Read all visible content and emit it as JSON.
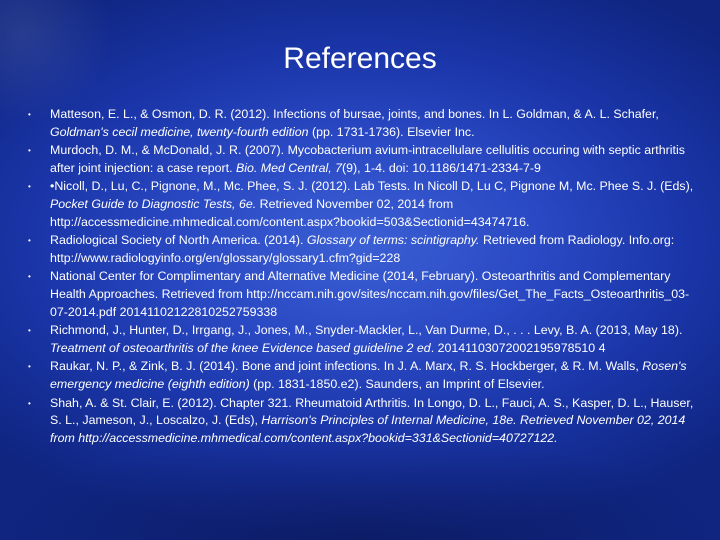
{
  "title": "References",
  "bullet": "•",
  "references": [
    [
      {
        "t": "Matteson, E. L., & Osmon, D. R. (2012). Infections of bursae, joints, and bones. In L. Goldman, & A. L. Schafer, ",
        "i": false
      },
      {
        "t": "Goldman's cecil medicine, twenty-fourth edition",
        "i": true
      },
      {
        "t": " (pp. 1731-1736). Elsevier Inc.",
        "i": false
      }
    ],
    [
      {
        "t": "Murdoch, D. M., & McDonald, J. R. (2007). Mycobacterium avium-intracellulare cellulitis occuring with septic arthritis after joint injection: a case report. ",
        "i": false
      },
      {
        "t": "Bio. Med Central, 7",
        "i": true
      },
      {
        "t": "(9), 1-4. doi: 10.1186/1471-2334-7-9",
        "i": false
      }
    ],
    [
      {
        "t": "•Nicoll, D., Lu, C., Pignone, M., Mc. Phee, S. J. (2012). Lab Tests. In Nicoll D, Lu C, Pignone M, Mc. Phee S. J. (Eds), ",
        "i": false
      },
      {
        "t": "Pocket Guide to Diagnostic Tests, 6e.",
        "i": true
      },
      {
        "t": " Retrieved November 02, 2014 from http://accessmedicine.mhmedical.com/content.aspx?bookid=503&Sectionid=43474716.",
        "i": false
      }
    ],
    [
      {
        "t": "Radiological Society of North America. (2014). ",
        "i": false
      },
      {
        "t": "Glossary of terms: scintigraphy.",
        "i": true
      },
      {
        "t": " Retrieved from Radiology. Info.org: http://www.radiologyinfo.org/en/glossary/glossary1.cfm?gid=228",
        "i": false
      }
    ],
    [
      {
        "t": "National Center for Complimentary and Alternative Medicine (2014, February). Osteoarthritis and Complementary Health Approaches. Retrieved from http://nccam.nih.gov/sites/nccam.nih.gov/files/Get_The_Facts_Osteoarthritis_03-07-2014.pdf 20141102122810252759338",
        "i": false
      }
    ],
    [
      {
        "t": "Richmond, J., Hunter, D., Irrgang, J., Jones, M., Snyder-Mackler, L., Van Durme, D., . . . Levy, B. A. (2013, May 18). ",
        "i": false
      },
      {
        "t": "Treatment of osteoarthritis of the knee Evidence based guideline 2 ed",
        "i": true
      },
      {
        "t": ". 20141103072002195978510 4",
        "i": false
      }
    ],
    [
      {
        "t": "Raukar, N. P., & Zink, B. J. (2014). Bone and joint infections. In J. A. Marx, R. S. Hockberger, & R. M. Walls, ",
        "i": false
      },
      {
        "t": "Rosen's emergency medicine (eighth edition)",
        "i": true
      },
      {
        "t": " (pp. 1831-1850.e2). Saunders, an Imprint of Elsevier.",
        "i": false
      }
    ],
    [
      {
        "t": "Shah, A. & St. Clair, E. (2012). Chapter 321. Rheumatoid Arthritis. In Longo, D. L., Fauci, A. S., Kasper, D. L., Hauser, S. L., Jameson, J., Loscalzo, J. (Eds), ",
        "i": false
      },
      {
        "t": "Harrison's Principles of Internal Medicine, 18e. Retrieved November 02, 2014 from http://accessmedicine.mhmedical.com/content.aspx?bookid=331&Sectionid=40727122.",
        "i": true
      }
    ]
  ]
}
